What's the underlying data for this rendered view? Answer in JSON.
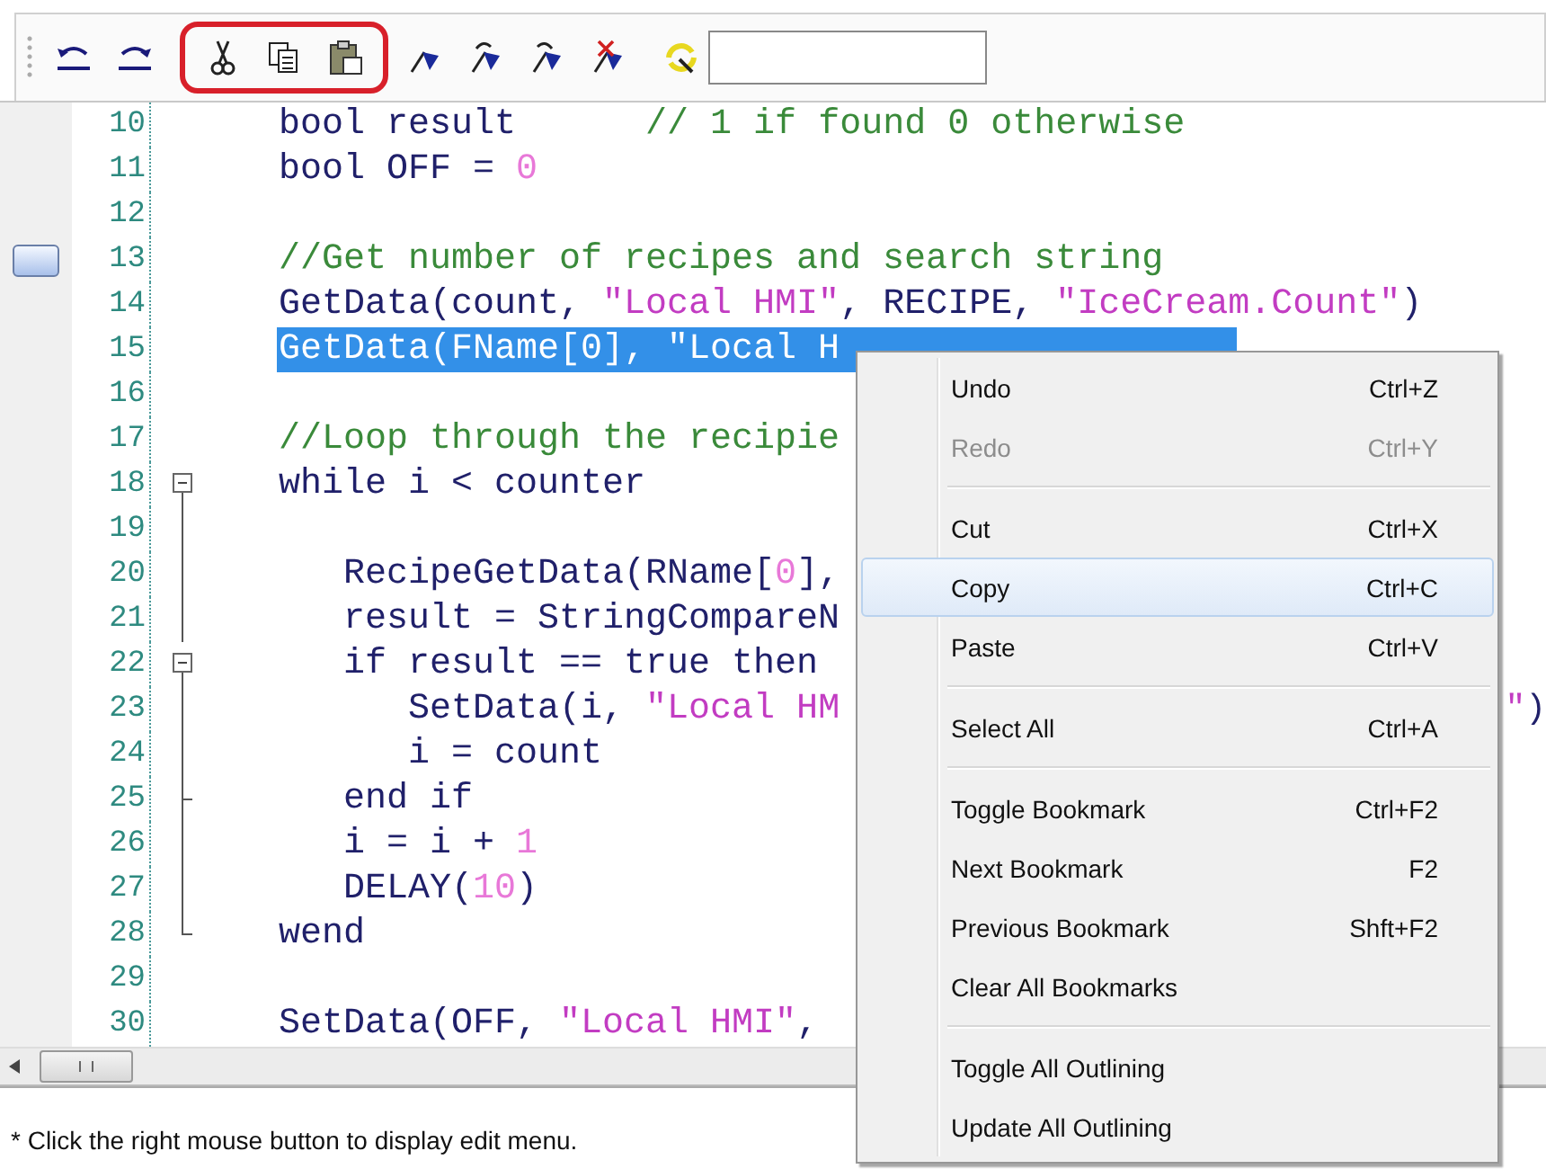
{
  "toolbar": {
    "clipboard_circled": true
  },
  "editor": {
    "lines": [
      {
        "number": "10",
        "kind": "plain",
        "tokens": [
          {
            "kind": "keyword",
            "text": "bool result      "
          },
          {
            "kind": "comment",
            "text": "// 1 if found 0 otherwise"
          }
        ]
      },
      {
        "number": "11",
        "kind": "plain",
        "tokens": [
          {
            "kind": "keyword",
            "text": "bool OFF = "
          },
          {
            "kind": "number",
            "text": "0"
          }
        ]
      },
      {
        "number": "12",
        "kind": "plain"
      },
      {
        "number": "13",
        "kind": "plain",
        "bookmarked": true,
        "tokens": [
          {
            "kind": "comment",
            "text": "//Get number of recipes and search string"
          }
        ]
      },
      {
        "number": "14",
        "kind": "plain",
        "tokens": [
          {
            "kind": "keyword",
            "text": "GetData(count, "
          },
          {
            "kind": "string",
            "text": "\"Local HMI\""
          },
          {
            "kind": "keyword",
            "text": ", RECIPE, "
          },
          {
            "kind": "string",
            "text": "\"IceCream.Count\""
          },
          {
            "kind": "keyword",
            "text": ")"
          }
        ]
      },
      {
        "number": "15",
        "kind": "plain",
        "selected": true,
        "tokens": [
          {
            "kind": "keyword",
            "text": "GetData(FName[0], \"Local H"
          }
        ]
      },
      {
        "number": "16",
        "kind": "plain"
      },
      {
        "number": "17",
        "kind": "plain",
        "tokens": [
          {
            "kind": "comment",
            "text": "//Loop through the recipie"
          }
        ]
      },
      {
        "number": "18",
        "kind": "fold_start",
        "tokens": [
          {
            "kind": "keyword",
            "text": "while i < counter"
          }
        ]
      },
      {
        "number": "19",
        "kind": "fold_line"
      },
      {
        "number": "20",
        "kind": "fold_line",
        "tokens": [
          {
            "kind": "keyword",
            "text": "   RecipeGetData(RName["
          },
          {
            "kind": "number",
            "text": "0"
          },
          {
            "kind": "keyword",
            "text": "],"
          }
        ]
      },
      {
        "number": "21",
        "kind": "fold_line",
        "tokens": [
          {
            "kind": "keyword",
            "text": "   result = StringCompareN"
          }
        ]
      },
      {
        "number": "22",
        "kind": "fold_start",
        "tokens": [
          {
            "kind": "keyword",
            "text": "   if result == true then"
          }
        ]
      },
      {
        "number": "23",
        "kind": "fold_line",
        "tokens": [
          {
            "kind": "keyword",
            "text": "      SetData(i, "
          },
          {
            "kind": "string",
            "text": "\"Local HM"
          }
        ],
        "tail": [
          {
            "kind": "string",
            "text": "\""
          },
          {
            "kind": "keyword",
            "text": ")"
          }
        ]
      },
      {
        "number": "24",
        "kind": "fold_line",
        "tokens": [
          {
            "kind": "keyword",
            "text": "      i = count"
          }
        ]
      },
      {
        "number": "25",
        "kind": "fold_tick",
        "tokens": [
          {
            "kind": "keyword",
            "text": "   end if"
          }
        ]
      },
      {
        "number": "26",
        "kind": "fold_line",
        "tokens": [
          {
            "kind": "keyword",
            "text": "   i = i + "
          },
          {
            "kind": "number",
            "text": "1"
          }
        ]
      },
      {
        "number": "27",
        "kind": "fold_line",
        "tokens": [
          {
            "kind": "keyword",
            "text": "   DELAY("
          },
          {
            "kind": "number",
            "text": "10"
          },
          {
            "kind": "keyword",
            "text": ")"
          }
        ]
      },
      {
        "number": "28",
        "kind": "fold_end",
        "tokens": [
          {
            "kind": "keyword",
            "text": "wend"
          }
        ]
      },
      {
        "number": "29",
        "kind": "plain"
      },
      {
        "number": "30",
        "kind": "plain",
        "tokens": [
          {
            "kind": "keyword",
            "text": "SetData(OFF, "
          },
          {
            "kind": "string",
            "text": "\"Local HMI\""
          },
          {
            "kind": "keyword",
            "text": ","
          }
        ]
      }
    ]
  },
  "context_menu": [
    {
      "kind": "item",
      "label": "Undo",
      "shortcut": "Ctrl+Z",
      "disabled": false,
      "selected": false
    },
    {
      "kind": "item",
      "label": "Redo",
      "shortcut": "Ctrl+Y",
      "disabled": true,
      "selected": false
    },
    {
      "kind": "separator"
    },
    {
      "kind": "item",
      "label": "Cut",
      "shortcut": "Ctrl+X",
      "disabled": false,
      "selected": false
    },
    {
      "kind": "item",
      "label": "Copy",
      "shortcut": "Ctrl+C",
      "disabled": false,
      "selected": true
    },
    {
      "kind": "item",
      "label": "Paste",
      "shortcut": "Ctrl+V",
      "disabled": false,
      "selected": false
    },
    {
      "kind": "separator"
    },
    {
      "kind": "item",
      "label": "Select All",
      "shortcut": "Ctrl+A",
      "disabled": false,
      "selected": false
    },
    {
      "kind": "separator"
    },
    {
      "kind": "item",
      "label": "Toggle Bookmark",
      "shortcut": "Ctrl+F2",
      "disabled": false,
      "selected": false
    },
    {
      "kind": "item",
      "label": "Next Bookmark",
      "shortcut": "F2",
      "disabled": false,
      "selected": false
    },
    {
      "kind": "item",
      "label": "Previous Bookmark",
      "shortcut": "Shft+F2",
      "disabled": false,
      "selected": false
    },
    {
      "kind": "item",
      "label": "Clear All Bookmarks",
      "disabled": false,
      "selected": false
    },
    {
      "kind": "separator"
    },
    {
      "kind": "item",
      "label": "Toggle All Outlining",
      "disabled": false,
      "selected": false
    },
    {
      "kind": "item",
      "label": "Update All Outlining",
      "disabled": false,
      "selected": false
    }
  ],
  "status_text": "* Click the right mouse button to display edit menu."
}
